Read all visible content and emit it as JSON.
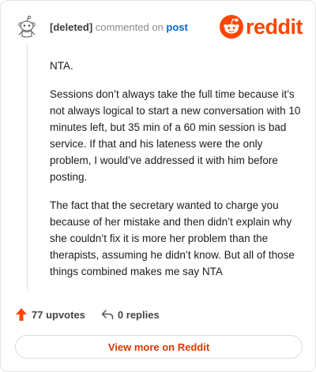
{
  "comment": {
    "author": "[deleted]",
    "action_text": "commented on",
    "target_text": "post",
    "paragraphs": [
      "NTA.",
      "Sessions don’t always take the full time because it’s not always logical to start a new conversation with 10 minutes left, but 35 min of a 60 min session is bad service. If that and his lateness were the only problem, I would’ve addressed it with him before posting.",
      "The fact that the secretary wanted to charge you because of her mistake and then didn’t explain why she couldn’t fix it is more her problem than the therapists, assuming he didn’t know. But all of those things combined makes me say NTA"
    ]
  },
  "brand": {
    "wordmark": "reddit",
    "color": "#ff4500"
  },
  "actions": {
    "upvotes": "77 upvotes",
    "replies": "0 replies"
  },
  "footer": {
    "view_more_label": "View more on Reddit"
  },
  "icons": {
    "avatar": "snoo-avatar-icon",
    "upvote": "upvote-arrow-icon",
    "reply": "reply-arrow-icon",
    "logo": "reddit-snoo-logo-icon"
  }
}
